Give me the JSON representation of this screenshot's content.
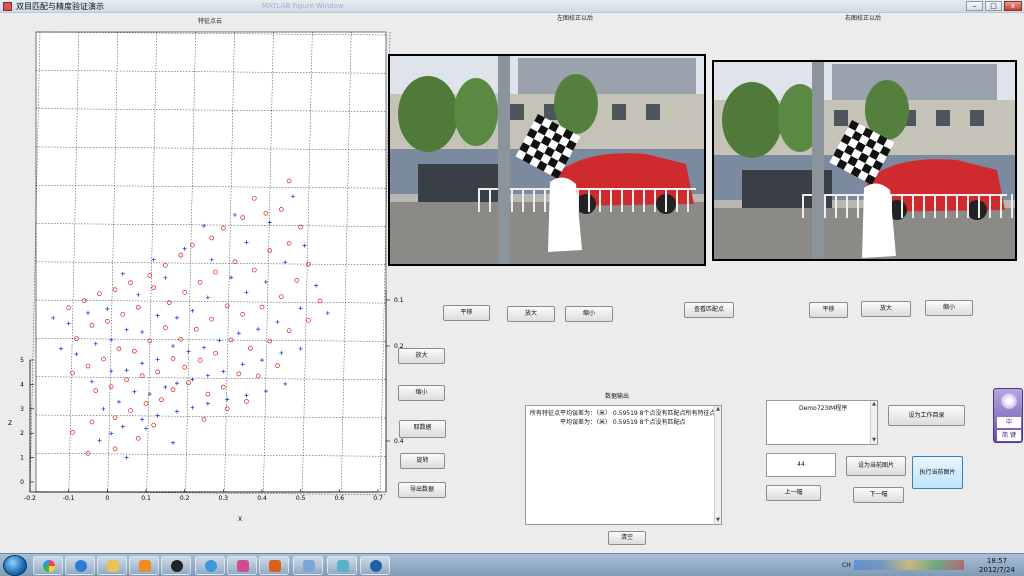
{
  "window": {
    "title": "双目匹配与精度验证演示",
    "ghost_title": "MATLAB Figure Window",
    "buttons": {
      "minimize": "–",
      "maximize": "□",
      "close": "x"
    }
  },
  "panels": {
    "features_title": "特征点云",
    "left_image_title": "左图校正以后",
    "right_image_title": "右图校正以后",
    "data_output_title": "数据输出"
  },
  "chart_data": {
    "type": "scatter",
    "title": "特征点云",
    "xlabel": "X",
    "zlabel": "Z",
    "xlim": [
      -0.2,
      0.7
    ],
    "zlim": [
      0,
      5
    ],
    "x_ticks": [
      "-0.2",
      "-0.1",
      "0",
      "0.1",
      "0.2",
      "0.3",
      "0.4",
      "0.5",
      "0.6",
      "0.7"
    ],
    "z_ticks": [
      "0",
      "1",
      "2",
      "3",
      "4",
      "5"
    ],
    "y_ticks": [
      "0.1",
      "0.2",
      "0.3",
      "0.4"
    ],
    "grid": true,
    "series": [
      {
        "marker": "o",
        "color": "#e11c1c",
        "points": [
          [
            0.47,
            4.45
          ],
          [
            0.45,
            4.0
          ],
          [
            0.41,
            3.95
          ],
          [
            0.38,
            4.2
          ],
          [
            0.35,
            3.9
          ],
          [
            0.3,
            3.75
          ],
          [
            0.27,
            3.6
          ],
          [
            0.22,
            3.5
          ],
          [
            0.19,
            3.35
          ],
          [
            0.15,
            3.2
          ],
          [
            0.11,
            3.05
          ],
          [
            0.06,
            2.95
          ],
          [
            0.02,
            2.85
          ],
          [
            -0.02,
            2.8
          ],
          [
            -0.06,
            2.7
          ],
          [
            -0.1,
            2.6
          ],
          [
            0.5,
            3.7
          ],
          [
            0.47,
            3.45
          ],
          [
            0.42,
            3.35
          ],
          [
            0.38,
            3.05
          ],
          [
            0.33,
            3.2
          ],
          [
            0.28,
            3.05
          ],
          [
            0.24,
            2.9
          ],
          [
            0.2,
            2.75
          ],
          [
            0.16,
            2.6
          ],
          [
            0.12,
            2.85
          ],
          [
            0.08,
            2.55
          ],
          [
            0.04,
            2.45
          ],
          [
            0.0,
            2.35
          ],
          [
            -0.04,
            2.3
          ],
          [
            -0.08,
            2.1
          ],
          [
            0.52,
            3.1
          ],
          [
            0.49,
            2.85
          ],
          [
            0.45,
            2.6
          ],
          [
            0.4,
            2.45
          ],
          [
            0.35,
            2.35
          ],
          [
            0.31,
            2.5
          ],
          [
            0.27,
            2.3
          ],
          [
            0.23,
            2.15
          ],
          [
            0.19,
            2.0
          ],
          [
            0.15,
            2.2
          ],
          [
            0.11,
            2.0
          ],
          [
            0.07,
            1.85
          ],
          [
            0.03,
            1.9
          ],
          [
            -0.01,
            1.75
          ],
          [
            -0.05,
            1.65
          ],
          [
            -0.09,
            1.55
          ],
          [
            0.55,
            2.5
          ],
          [
            0.52,
            2.2
          ],
          [
            0.47,
            2.05
          ],
          [
            0.42,
            1.9
          ],
          [
            0.37,
            1.8
          ],
          [
            0.32,
            1.95
          ],
          [
            0.28,
            1.75
          ],
          [
            0.24,
            1.65
          ],
          [
            0.2,
            1.55
          ],
          [
            0.17,
            1.7
          ],
          [
            0.13,
            1.5
          ],
          [
            0.09,
            1.45
          ],
          [
            0.05,
            1.4
          ],
          [
            0.01,
            1.3
          ],
          [
            -0.03,
            1.25
          ],
          [
            0.44,
            1.5
          ],
          [
            0.39,
            1.35
          ],
          [
            0.34,
            1.4
          ],
          [
            0.3,
            1.2
          ],
          [
            0.26,
            1.1
          ],
          [
            0.21,
            1.3
          ],
          [
            0.17,
            1.2
          ],
          [
            0.14,
            1.05
          ],
          [
            0.1,
            1.0
          ],
          [
            0.06,
            0.9
          ],
          [
            0.02,
            0.8
          ],
          [
            -0.04,
            0.75
          ],
          [
            -0.09,
            0.6
          ],
          [
            0.36,
            0.95
          ],
          [
            0.31,
            0.85
          ],
          [
            0.25,
            0.7
          ],
          [
            0.12,
            0.65
          ],
          [
            0.08,
            0.45
          ],
          [
            0.02,
            0.3
          ],
          [
            -0.05,
            0.25
          ]
        ]
      },
      {
        "marker": "+",
        "color": "#1c28d6",
        "points": [
          [
            0.48,
            4.2
          ],
          [
            0.42,
            3.8
          ],
          [
            0.36,
            3.5
          ],
          [
            0.33,
            3.95
          ],
          [
            0.27,
            3.25
          ],
          [
            0.25,
            3.8
          ],
          [
            0.2,
            3.45
          ],
          [
            0.15,
            3.0
          ],
          [
            0.12,
            3.3
          ],
          [
            0.08,
            2.75
          ],
          [
            0.04,
            3.1
          ],
          [
            -0.0,
            2.55
          ],
          [
            -0.05,
            2.5
          ],
          [
            -0.1,
            2.35
          ],
          [
            -0.14,
            2.45
          ],
          [
            0.51,
            3.4
          ],
          [
            0.46,
            3.15
          ],
          [
            0.41,
            2.85
          ],
          [
            0.36,
            2.7
          ],
          [
            0.32,
            2.95
          ],
          [
            0.26,
            2.65
          ],
          [
            0.22,
            2.45
          ],
          [
            0.18,
            2.35
          ],
          [
            0.13,
            2.4
          ],
          [
            0.09,
            2.15
          ],
          [
            0.05,
            2.2
          ],
          [
            0.01,
            2.05
          ],
          [
            -0.03,
            2.0
          ],
          [
            -0.08,
            1.85
          ],
          [
            -0.12,
            1.95
          ],
          [
            0.54,
            2.75
          ],
          [
            0.5,
            2.4
          ],
          [
            0.44,
            2.2
          ],
          [
            0.39,
            2.1
          ],
          [
            0.34,
            2.05
          ],
          [
            0.29,
            1.95
          ],
          [
            0.25,
            1.85
          ],
          [
            0.21,
            1.8
          ],
          [
            0.17,
            1.9
          ],
          [
            0.13,
            1.7
          ],
          [
            0.09,
            1.65
          ],
          [
            0.05,
            1.55
          ],
          [
            0.01,
            1.55
          ],
          [
            -0.04,
            1.4
          ],
          [
            0.57,
            2.3
          ],
          [
            0.5,
            1.75
          ],
          [
            0.45,
            1.7
          ],
          [
            0.4,
            1.6
          ],
          [
            0.35,
            1.55
          ],
          [
            0.3,
            1.45
          ],
          [
            0.26,
            1.4
          ],
          [
            0.22,
            1.35
          ],
          [
            0.18,
            1.3
          ],
          [
            0.15,
            1.25
          ],
          [
            0.11,
            1.15
          ],
          [
            0.07,
            1.2
          ],
          [
            0.03,
            1.05
          ],
          [
            -0.01,
            0.95
          ],
          [
            0.46,
            1.2
          ],
          [
            0.41,
            1.1
          ],
          [
            0.36,
            1.05
          ],
          [
            0.31,
            1.0
          ],
          [
            0.26,
            0.95
          ],
          [
            0.22,
            0.9
          ],
          [
            0.18,
            0.85
          ],
          [
            0.13,
            0.8
          ],
          [
            0.09,
            0.75
          ],
          [
            0.04,
            0.65
          ],
          [
            0.01,
            0.55
          ],
          [
            -0.02,
            0.45
          ],
          [
            0.17,
            0.35
          ],
          [
            0.1,
            0.6
          ],
          [
            0.05,
            0.15
          ]
        ]
      }
    ]
  },
  "controls": {
    "zoom_in": "放大",
    "zoom_out": "缩小",
    "get_data": "取数据",
    "rotate": "旋转",
    "export_data": "导出数据",
    "pan_left": "平移",
    "zoom_in_left": "放大",
    "zoom_out_left": "缩小",
    "view_matches": "查看匹配点",
    "pan_right": "平移",
    "zoom_in_right": "放大",
    "zoom_out_right": "缩小",
    "clear": "清空",
    "set_workdir": "设为工作目录",
    "set_current_image": "设为当前图片",
    "run_current_image": "执行当前图片",
    "prev": "上一幅",
    "next": "下一幅"
  },
  "output": {
    "lines": [
      "所有特征点平均误差为：（米） 0.59519 8个点没有匹配点所有特征点",
      "平均误差为：（米） 0.59519 8个点没有匹配点"
    ]
  },
  "file_list": {
    "items": [
      "Demo723IM程序"
    ]
  },
  "image_index": "44",
  "ime": {
    "line1": "中",
    "line2": "简 键"
  },
  "clock": {
    "time": "18:57",
    "date": "2012/7/24"
  },
  "tray": {
    "lang": "CH"
  }
}
